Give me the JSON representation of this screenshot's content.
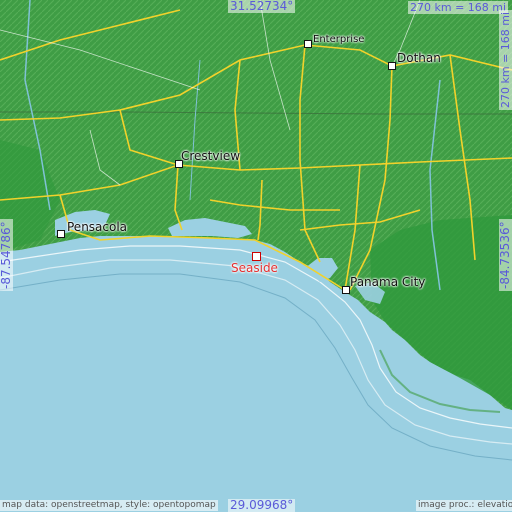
{
  "map": {
    "coordinates": {
      "north": "31.52734°",
      "south": "29.09968°",
      "west": "-87.54786°",
      "east": "-84.73536°"
    },
    "scale": "270 km = 168 mi",
    "focus_city": "Seaside",
    "cities": {
      "enterprise": "Enterprise",
      "dothan": "Dothan",
      "crestview": "Crestview",
      "pensacola": "Pensacola",
      "panama_city": "Panama City"
    },
    "attribution": {
      "left": "map data: openstreetmap, style: opentopomap",
      "right": "image proc.: elevation.city"
    },
    "colors": {
      "land": "#4ea84a",
      "land_dark": "#2f8f3a",
      "water": "#9bd0e2",
      "roads": "#f2d22b",
      "focus": "#e53030",
      "coords": "#5a5ad8"
    }
  }
}
